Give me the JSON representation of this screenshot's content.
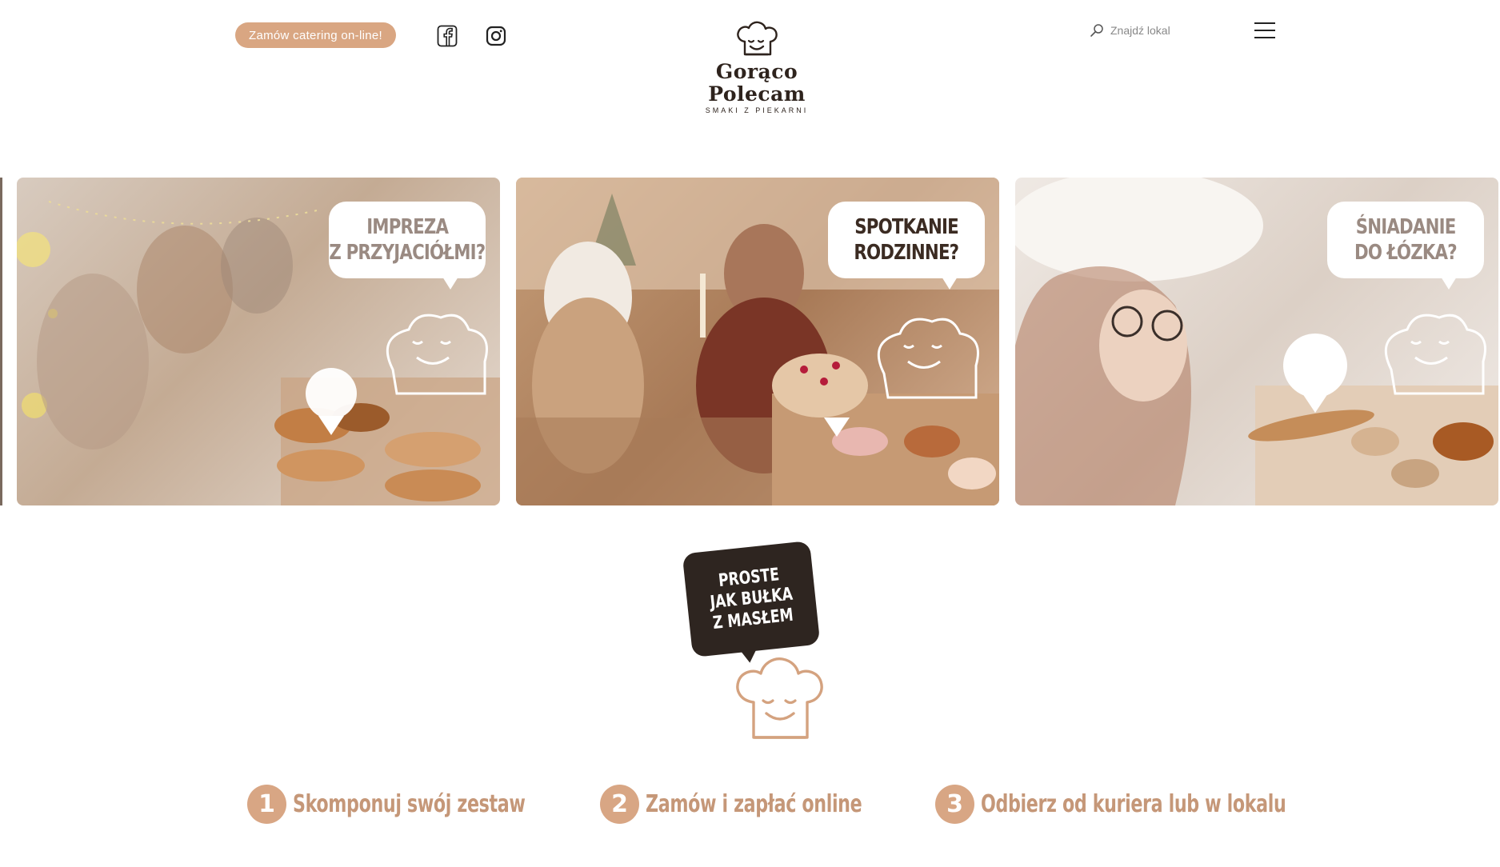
{
  "header": {
    "catering_button": "Zamów catering on-line!",
    "social": [
      "facebook-icon",
      "instagram-icon"
    ],
    "logo": {
      "brand": "Gorąco Polecam",
      "tagline": "SMAKI Z PIEKARNI"
    },
    "search": {
      "placeholder": "Znajdź lokal"
    },
    "menu_icon": "hamburger-menu-icon"
  },
  "occasions": [
    {
      "line1": "IMPREZA",
      "line2": "Z PRZYJACIÓŁMI?"
    },
    {
      "line1": "SPOTKANIE",
      "line2": "RODZINNE?"
    },
    {
      "line1": "ŚNIADANIE",
      "line2": "DO ŁÓZKA?"
    }
  ],
  "badge": {
    "line1": "PROSTE",
    "line2": "JAK BUŁKA",
    "line3": "Z MASŁEM"
  },
  "steps": [
    {
      "number": "1",
      "label": "Skomponuj swój zestaw"
    },
    {
      "number": "2",
      "label": "Zamów i zapłać online"
    },
    {
      "number": "3",
      "label": "Odbierz od kuriera lub w lokalu"
    }
  ],
  "colors": {
    "accent": "#d9a682",
    "dark": "#2e2520",
    "step_text": "#c59778"
  }
}
